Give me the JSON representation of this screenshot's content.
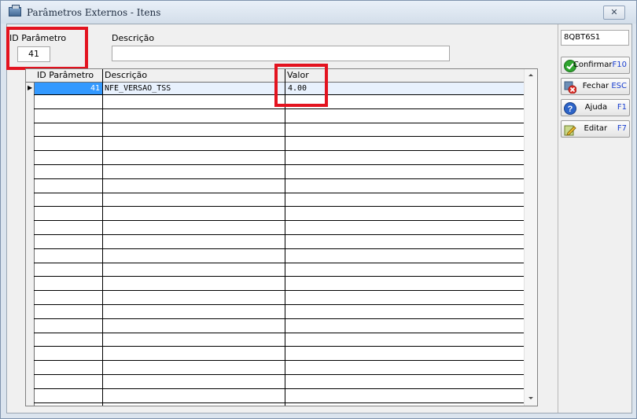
{
  "window": {
    "title": "Parâmetros Externos - Itens",
    "close_symbol": "✕"
  },
  "form": {
    "id_label": "ID Parâmetro",
    "id_value": "41",
    "desc_label": "Descrição",
    "desc_value": ""
  },
  "grid": {
    "columns": [
      "ID Parâmetro",
      "Descrição",
      "Valor"
    ],
    "rows": [
      {
        "id": "41",
        "descricao": "NFE_VERSAO_TSS",
        "valor": "4.00"
      }
    ]
  },
  "sidebar": {
    "code": "8QBT6S1",
    "buttons": [
      {
        "label": "Confirmar",
        "key": "F10",
        "icon": "confirm-check-icon"
      },
      {
        "label": "Fechar",
        "key": "ESC",
        "icon": "close-x-icon"
      },
      {
        "label": "Ajuda",
        "key": "F1",
        "icon": "help-icon"
      },
      {
        "label": "Editar",
        "key": "F7",
        "icon": "edit-pencil-icon"
      }
    ]
  },
  "colors": {
    "highlight": "#e3131f",
    "selection": "#3399ff",
    "hotkey": "#1a3fd0"
  }
}
